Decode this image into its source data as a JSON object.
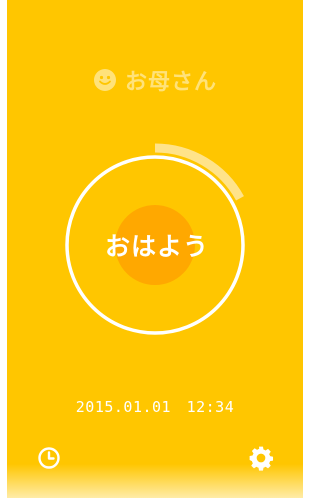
{
  "header": {
    "icon": "smile-icon",
    "contact_name": "お母さん"
  },
  "main": {
    "greeting_button": "おはよう",
    "progress_fraction": 0.17
  },
  "footer": {
    "datetime": "2015.01.01　12:34",
    "history_icon": "clock-icon",
    "settings_icon": "gear-icon"
  },
  "colors": {
    "background": "#FFC600",
    "center_accent": "#FFA800",
    "ring": "#FFFFFF",
    "progress_arc": "#FFE38A"
  }
}
